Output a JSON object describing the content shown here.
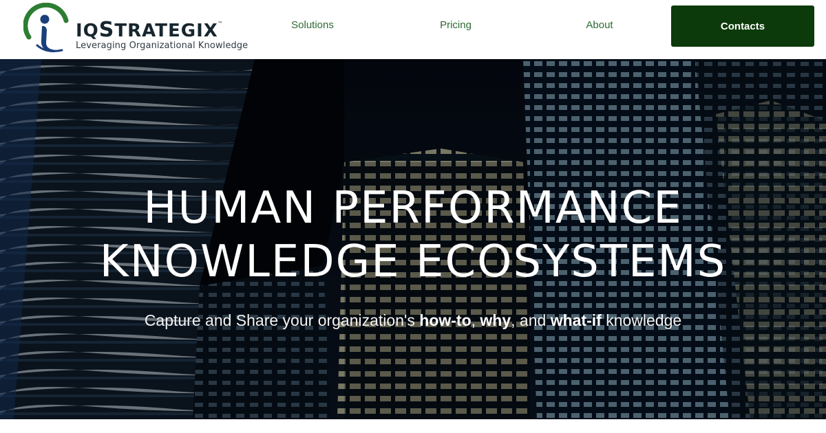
{
  "brand": {
    "name_first": "IQ",
    "name_rest_big": "S",
    "name_rest": "TRATEGIX",
    "trademark": "™",
    "tagline": "Leveraging Organizational Knowledge",
    "logo_icon": "person-swoosh-icon",
    "colors": {
      "green": "#2d7d32",
      "navy": "#17262f",
      "blue": "#1b3f7a"
    }
  },
  "nav": {
    "items": [
      {
        "label": "Solutions"
      },
      {
        "label": "Pricing"
      },
      {
        "label": "About"
      }
    ],
    "cta_label": "Contacts",
    "cta_color": "#0c3a0b",
    "link_color": "#2f6a35"
  },
  "hero": {
    "title_line1": "HUMAN PERFORMANCE",
    "title_line2": "KNOWLEDGE ECOSYSTEMS",
    "subtitle": {
      "part1": "Capture and Share your organization's ",
      "bold1": "how-to",
      "part2": ", ",
      "bold2": "why",
      "part3": ", and ",
      "bold3": "what-if",
      "part4": " knowledge"
    },
    "background": "night-city-skyscrapers-image"
  }
}
